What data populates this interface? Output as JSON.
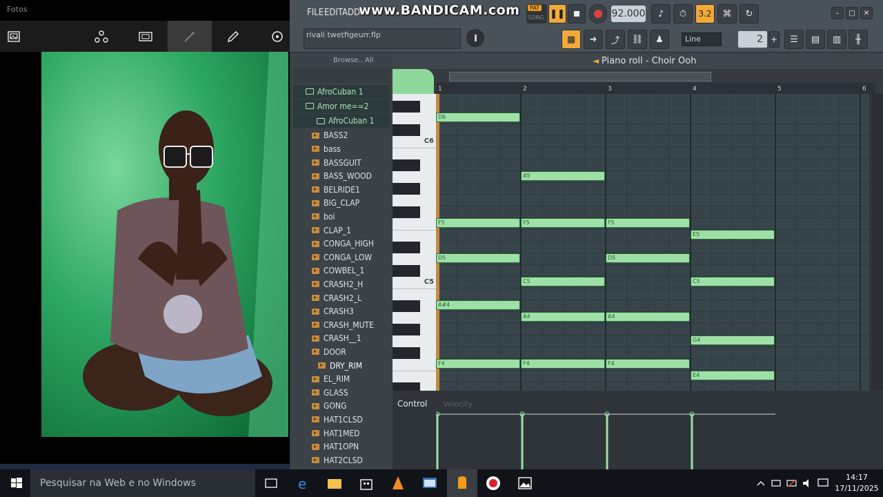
{
  "photos": {
    "title": "Fotos",
    "toolbar": [
      "image-icon",
      "crop-people-icon",
      "slideshow-icon",
      "magic-wand-icon",
      "pencil-icon",
      "rotate-icon"
    ]
  },
  "fl": {
    "menu": [
      "FILE",
      "EDIT",
      "ADD"
    ],
    "watermark": "www.BANDICAM.com",
    "pat_label": "PAT",
    "song_label": "SONG",
    "tempo": "92.000",
    "hint": "rivali twetfigeurr.flp",
    "snap": "Line",
    "step": "2",
    "pattern_counter": "3.2"
  },
  "browser": {
    "header": "Browse..   All",
    "folders": [
      "AfroCuban 1",
      "Amor me==2",
      "AfroCuban 1"
    ],
    "items": [
      "BASS2",
      "bass",
      "BASSGUIT",
      "BASS_WOOD",
      "BELRIDE1",
      "BIG_CLAP",
      "boi",
      "CLAP_1",
      "CONGA_HIGH",
      "CONGA_LOW",
      "COWBEL_1",
      "CRASH2_H",
      "CRASH2_L",
      "CRASH3",
      "CRASH_MUTE",
      "CRASH__1",
      "DOOR",
      "DRY_RIM",
      "EL_RIM",
      "GLASS",
      "GONG",
      "HAT1CLSD",
      "HAT1MED",
      "HAT1OPN",
      "HAT2CLSD"
    ],
    "selected": "DRY_RIM"
  },
  "piano_roll": {
    "title": "Piano roll - Choir Ooh",
    "ruler": [
      "1",
      "2",
      "3",
      "4",
      "5",
      "6"
    ],
    "octave_labels": [
      "C6",
      "C5"
    ],
    "notes": [
      {
        "name": "D6",
        "bar": 1,
        "row": 0
      },
      {
        "name": "A5",
        "bar": 2,
        "row": 5
      },
      {
        "name": "F5",
        "bar": 1,
        "row": 9
      },
      {
        "name": "F5",
        "bar": 2,
        "row": 9
      },
      {
        "name": "F5",
        "bar": 3,
        "row": 9
      },
      {
        "name": "E5",
        "bar": 4,
        "row": 10
      },
      {
        "name": "D5",
        "bar": 1,
        "row": 12
      },
      {
        "name": "D5",
        "bar": 3,
        "row": 12
      },
      {
        "name": "C5",
        "bar": 2,
        "row": 14
      },
      {
        "name": "C5",
        "bar": 4,
        "row": 14
      },
      {
        "name": "A#4",
        "bar": 1,
        "row": 16
      },
      {
        "name": "A4",
        "bar": 2,
        "row": 17
      },
      {
        "name": "A4",
        "bar": 3,
        "row": 17
      },
      {
        "name": "G4",
        "bar": 4,
        "row": 19
      },
      {
        "name": "F4",
        "bar": 1,
        "row": 21
      },
      {
        "name": "F4",
        "bar": 2,
        "row": 21
      },
      {
        "name": "F4",
        "bar": 3,
        "row": 21
      },
      {
        "name": "E4",
        "bar": 4,
        "row": 22
      }
    ],
    "control_label": "Control",
    "control_target": "Velocity"
  },
  "taskbar": {
    "search_placeholder": "Pesquisar na Web e no Windows",
    "time": "14:17",
    "date": "17/11/2025"
  }
}
